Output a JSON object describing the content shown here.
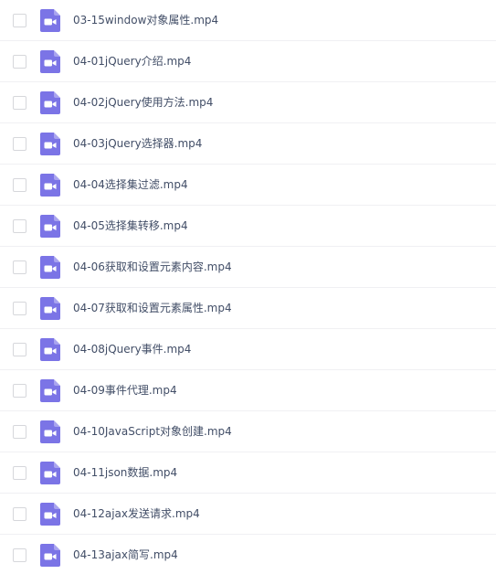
{
  "file_icon": "video-file-icon",
  "accent_color": "#7b74e6",
  "files": [
    {
      "name": "03-15window对象属性.mp4"
    },
    {
      "name": "04-01jQuery介绍.mp4"
    },
    {
      "name": "04-02jQuery使用方法.mp4"
    },
    {
      "name": "04-03jQuery选择器.mp4"
    },
    {
      "name": "04-04选择集过滤.mp4"
    },
    {
      "name": "04-05选择集转移.mp4"
    },
    {
      "name": "04-06获取和设置元素内容.mp4"
    },
    {
      "name": "04-07获取和设置元素属性.mp4"
    },
    {
      "name": "04-08jQuery事件.mp4"
    },
    {
      "name": "04-09事件代理.mp4"
    },
    {
      "name": "04-10JavaScript对象创建.mp4"
    },
    {
      "name": "04-11json数据.mp4"
    },
    {
      "name": "04-12ajax发送请求.mp4"
    },
    {
      "name": "04-13ajax简写.mp4"
    }
  ]
}
